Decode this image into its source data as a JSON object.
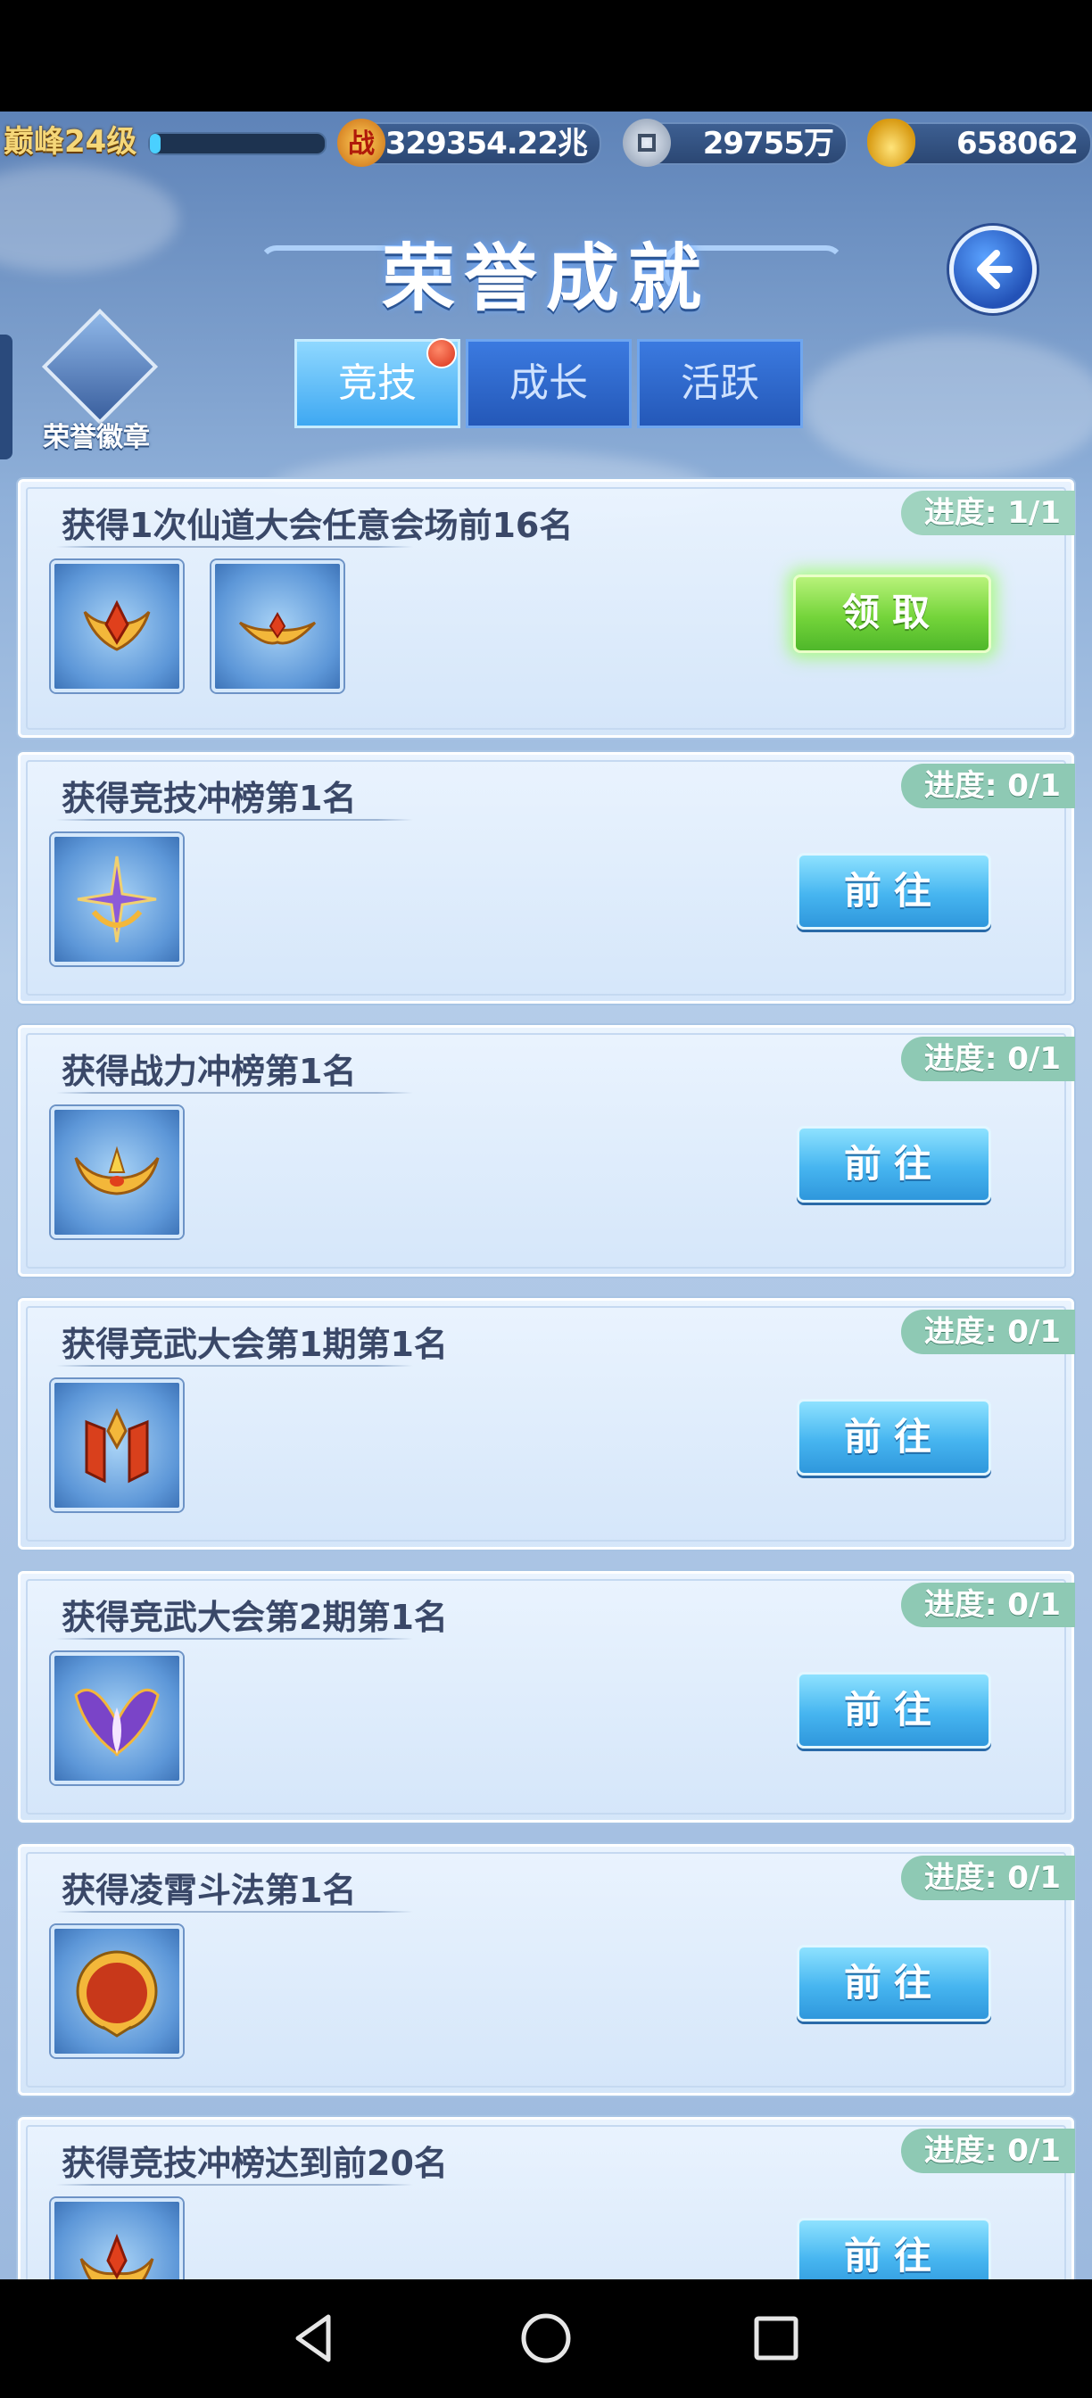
{
  "resources": {
    "level": "巅峰24级",
    "xp_fraction": 0.06,
    "power": "329354.22兆",
    "coins": "29755万",
    "ingots": "658062"
  },
  "header": {
    "title": "荣誉成就"
  },
  "badge": {
    "label": "荣誉徽章"
  },
  "tabs": [
    {
      "label": "竞技",
      "active": true,
      "has_dot": true
    },
    {
      "label": "成长",
      "active": false
    },
    {
      "label": "活跃",
      "active": false
    }
  ],
  "achievements": [
    {
      "title": "获得1次仙道大会任意会场前16名",
      "progress": "进度: 1/1",
      "rewards": [
        "crown-red-gem-icon",
        "crest-gold-icon"
      ],
      "button": "领取",
      "claimable": true
    },
    {
      "title": "获得竞技冲榜第1名",
      "progress": "进度: 0/1",
      "rewards": [
        "purple-star-trident-icon"
      ],
      "button": "前往",
      "claimable": false
    },
    {
      "title": "获得战力冲榜第1名",
      "progress": "进度: 0/1",
      "rewards": [
        "gold-horns-crown-icon"
      ],
      "button": "前往",
      "claimable": false
    },
    {
      "title": "获得竞武大会第1期第1名",
      "progress": "进度: 0/1",
      "rewards": [
        "red-banner-crest-icon"
      ],
      "button": "前往",
      "claimable": false
    },
    {
      "title": "获得竞武大会第2期第1名",
      "progress": "进度: 0/1",
      "rewards": [
        "purple-wings-icon"
      ],
      "button": "前往",
      "claimable": false
    },
    {
      "title": "获得凌霄斗法第1名",
      "progress": "进度: 0/1",
      "rewards": [
        "red-mirror-frame-icon"
      ],
      "button": "前往",
      "claimable": false
    },
    {
      "title": "获得竞技冲榜达到前20名",
      "progress": "进度: 0/1",
      "rewards": [
        "gold-crown-icon"
      ],
      "button": "前往",
      "claimable": false
    }
  ],
  "colors": {
    "accent_blue": "#3ea8f2",
    "claim_green": "#74d43a",
    "progress_green": "#8ec9b4",
    "title_text": "#3a4868"
  }
}
